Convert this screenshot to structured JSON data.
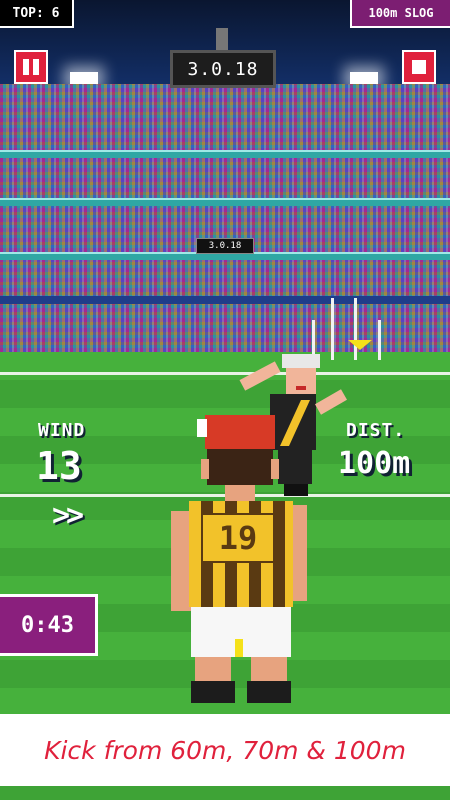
{
  "hud": {
    "top_score": "TOP: 6",
    "mode": "100m SLOG",
    "scoreboard": "3.0.18",
    "mini_scoreboard": "3.0.18",
    "wind_label": "WIND",
    "wind_value": "13",
    "wind_arrows": ">>",
    "dist_label": "DIST.",
    "dist_value": "100m",
    "timer": "0:43"
  },
  "player": {
    "jersey_number": "19"
  },
  "banner": {
    "text": "Kick from 60m, 70m & 100m"
  },
  "colors": {
    "accent_red": "#e0213c",
    "purple": "#8a1f7d",
    "grass": "#46b13c",
    "guernsey_yellow": "#f2c22a",
    "guernsey_brown": "#5a3a12"
  },
  "icons": {
    "pause": "pause-icon",
    "stop": "stop-icon"
  }
}
